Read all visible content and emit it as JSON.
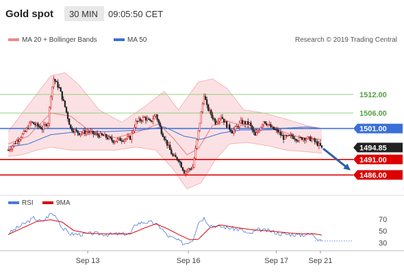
{
  "header": {
    "title": "Gold spot",
    "interval": "30 MIN",
    "time": "09:05:50 CET"
  },
  "legend": {
    "ma20_label": "MA 20 + Bollinger Bands",
    "ma50_label": "MA 50",
    "credit": "Research © 2019 Trading Central",
    "rsi_label": "RSI",
    "ma9_label": "9MA"
  },
  "colors": {
    "candle_up": "#cc0000",
    "candle_down": "#222222",
    "bollinger_band": "#f8c8cc",
    "ma20": "#e87a80",
    "ma50": "#3a6fd8",
    "green_level": "#90d080",
    "red_level": "#dd0000",
    "blue_level": "#3a6fd8",
    "arrow": "#2b5ea8",
    "rsi_line": "#4a78d8",
    "rsi_ma": "#dd0000"
  },
  "chart_data": {
    "type": "candlestick",
    "instrument": "Gold spot",
    "timeframe": "30 MIN",
    "y_axis": {
      "min": 1481,
      "max": 1527
    },
    "levels": [
      {
        "value": 1512.0,
        "label": "1512.00",
        "color": "#90d080",
        "style": "green"
      },
      {
        "value": 1506.0,
        "label": "1506.00",
        "color": "#90d080",
        "style": "green"
      },
      {
        "value": 1501.0,
        "label": "1501.00",
        "color": "#3a6fd8",
        "style": "box"
      },
      {
        "value": 1494.85,
        "label": "1494.85",
        "color": "#222222",
        "style": "box"
      },
      {
        "value": 1491.0,
        "label": "1491.00",
        "color": "#dd0000",
        "style": "box"
      },
      {
        "value": 1486.0,
        "label": "1486.00",
        "color": "#dd0000",
        "style": "box"
      }
    ],
    "current_price": 1494.85,
    "x_labels": [
      "Sep 13",
      "Sep 16",
      "Sep 17",
      "Sep 21"
    ],
    "forecast_arrow": {
      "from": 1494.5,
      "to": 1487.5
    },
    "price_anchors": [
      [
        0,
        1494.0
      ],
      [
        6,
        1497.0
      ],
      [
        12,
        1500.0
      ],
      [
        16,
        1503.0
      ],
      [
        20,
        1502.0
      ],
      [
        24,
        1501.0
      ],
      [
        28,
        1503.0
      ],
      [
        30,
        1512.0
      ],
      [
        32,
        1517.0
      ],
      [
        36,
        1514.0
      ],
      [
        40,
        1508.0
      ],
      [
        44,
        1501.0
      ],
      [
        50,
        1499.5
      ],
      [
        56,
        1500.0
      ],
      [
        62,
        1499.0
      ],
      [
        68,
        1498.5
      ],
      [
        74,
        1497.0
      ],
      [
        80,
        1497.5
      ],
      [
        86,
        1498.0
      ],
      [
        90,
        1503.0
      ],
      [
        96,
        1504.5
      ],
      [
        100,
        1503.0
      ],
      [
        104,
        1505.5
      ],
      [
        108,
        1500.0
      ],
      [
        112,
        1496.0
      ],
      [
        116,
        1492.0
      ],
      [
        120,
        1491.0
      ],
      [
        124,
        1487.0
      ],
      [
        130,
        1488.5
      ],
      [
        134,
        1500.0
      ],
      [
        138,
        1512.0
      ],
      [
        140,
        1508.0
      ],
      [
        146,
        1503.0
      ],
      [
        150,
        1505.0
      ],
      [
        154,
        1502.0
      ],
      [
        158,
        1500.0
      ],
      [
        164,
        1503.0
      ],
      [
        170,
        1502.5
      ],
      [
        174,
        1498.5
      ],
      [
        176,
        1500.0
      ],
      [
        180,
        1503.5
      ],
      [
        186,
        1501.0
      ],
      [
        190,
        1500.0
      ],
      [
        194,
        1498.0
      ],
      [
        200,
        1498.5
      ],
      [
        204,
        1497.5
      ],
      [
        208,
        1498.0
      ],
      [
        214,
        1497.5
      ],
      [
        218,
        1496.0
      ],
      [
        221,
        1494.85
      ]
    ],
    "ma20_anchors": [
      [
        0,
        1496.0
      ],
      [
        14,
        1498.5
      ],
      [
        30,
        1506.0
      ],
      [
        44,
        1505.0
      ],
      [
        58,
        1500.0
      ],
      [
        76,
        1498.0
      ],
      [
        92,
        1500.0
      ],
      [
        106,
        1502.5
      ],
      [
        116,
        1498.0
      ],
      [
        126,
        1492.5
      ],
      [
        134,
        1494.5
      ],
      [
        144,
        1502.0
      ],
      [
        154,
        1503.5
      ],
      [
        164,
        1502.0
      ],
      [
        176,
        1500.5
      ],
      [
        190,
        1500.5
      ],
      [
        206,
        1498.0
      ],
      [
        221,
        1497.5
      ]
    ],
    "upper_band_anchors": [
      [
        0,
        1500.0
      ],
      [
        10,
        1506.0
      ],
      [
        20,
        1512.0
      ],
      [
        30,
        1518.0
      ],
      [
        40,
        1519.0
      ],
      [
        50,
        1515.0
      ],
      [
        64,
        1507.0
      ],
      [
        80,
        1503.0
      ],
      [
        96,
        1508.0
      ],
      [
        110,
        1513.0
      ],
      [
        120,
        1507.0
      ],
      [
        134,
        1516.0
      ],
      [
        144,
        1517.0
      ],
      [
        154,
        1514.0
      ],
      [
        166,
        1507.0
      ],
      [
        180,
        1506.0
      ],
      [
        196,
        1504.0
      ],
      [
        210,
        1502.0
      ],
      [
        221,
        1501.0
      ]
    ],
    "lower_band_anchors": [
      [
        0,
        1492.0
      ],
      [
        10,
        1492.5
      ],
      [
        20,
        1494.0
      ],
      [
        30,
        1495.0
      ],
      [
        44,
        1494.0
      ],
      [
        58,
        1494.0
      ],
      [
        76,
        1494.0
      ],
      [
        90,
        1495.0
      ],
      [
        104,
        1494.0
      ],
      [
        116,
        1488.0
      ],
      [
        126,
        1481.5
      ],
      [
        136,
        1483.5
      ],
      [
        146,
        1491.0
      ],
      [
        156,
        1496.0
      ],
      [
        168,
        1496.5
      ],
      [
        182,
        1495.5
      ],
      [
        196,
        1494.0
      ],
      [
        210,
        1493.5
      ],
      [
        221,
        1493.0
      ]
    ],
    "ma50_anchors": [
      [
        0,
        1495.0
      ],
      [
        14,
        1496.0
      ],
      [
        30,
        1499.0
      ],
      [
        50,
        1500.0
      ],
      [
        70,
        1500.0
      ],
      [
        94,
        1500.5
      ],
      [
        110,
        1501.5
      ],
      [
        124,
        1498.5
      ],
      [
        136,
        1497.5
      ],
      [
        150,
        1499.5
      ],
      [
        164,
        1500.5
      ],
      [
        178,
        1500.5
      ],
      [
        192,
        1501.0
      ],
      [
        210,
        1501.5
      ],
      [
        221,
        1501.0
      ]
    ],
    "rsi": {
      "label": "RSI",
      "ma_label": "9MA",
      "y_ticks": [
        30,
        50,
        70
      ],
      "y_range": [
        20,
        85
      ],
      "rsi_anchors": [
        [
          0,
          45
        ],
        [
          6,
          55
        ],
        [
          12,
          63
        ],
        [
          18,
          72
        ],
        [
          24,
          65
        ],
        [
          30,
          80
        ],
        [
          34,
          75
        ],
        [
          38,
          55
        ],
        [
          44,
          45
        ],
        [
          52,
          44
        ],
        [
          60,
          46
        ],
        [
          70,
          44
        ],
        [
          78,
          45
        ],
        [
          86,
          45
        ],
        [
          90,
          62
        ],
        [
          96,
          65
        ],
        [
          102,
          64
        ],
        [
          108,
          55
        ],
        [
          112,
          42
        ],
        [
          118,
          36
        ],
        [
          124,
          28
        ],
        [
          130,
          35
        ],
        [
          134,
          65
        ],
        [
          138,
          72
        ],
        [
          142,
          60
        ],
        [
          148,
          58
        ],
        [
          156,
          55
        ],
        [
          164,
          52
        ],
        [
          170,
          44
        ],
        [
          176,
          52
        ],
        [
          184,
          50
        ],
        [
          192,
          45
        ],
        [
          200,
          44
        ],
        [
          206,
          43
        ],
        [
          214,
          45
        ],
        [
          218,
          38
        ],
        [
          221,
          36
        ]
      ],
      "ma_anchors": [
        [
          0,
          44
        ],
        [
          10,
          55
        ],
        [
          20,
          66
        ],
        [
          30,
          69
        ],
        [
          38,
          65
        ],
        [
          46,
          51
        ],
        [
          56,
          46
        ],
        [
          70,
          45
        ],
        [
          86,
          45
        ],
        [
          96,
          55
        ],
        [
          104,
          62
        ],
        [
          112,
          54
        ],
        [
          120,
          44
        ],
        [
          128,
          35
        ],
        [
          134,
          36
        ],
        [
          142,
          55
        ],
        [
          150,
          60
        ],
        [
          160,
          56
        ],
        [
          172,
          52
        ],
        [
          184,
          50
        ],
        [
          196,
          47
        ],
        [
          206,
          45
        ],
        [
          216,
          45
        ],
        [
          221,
          43
        ]
      ],
      "dotted_level": 33
    }
  }
}
